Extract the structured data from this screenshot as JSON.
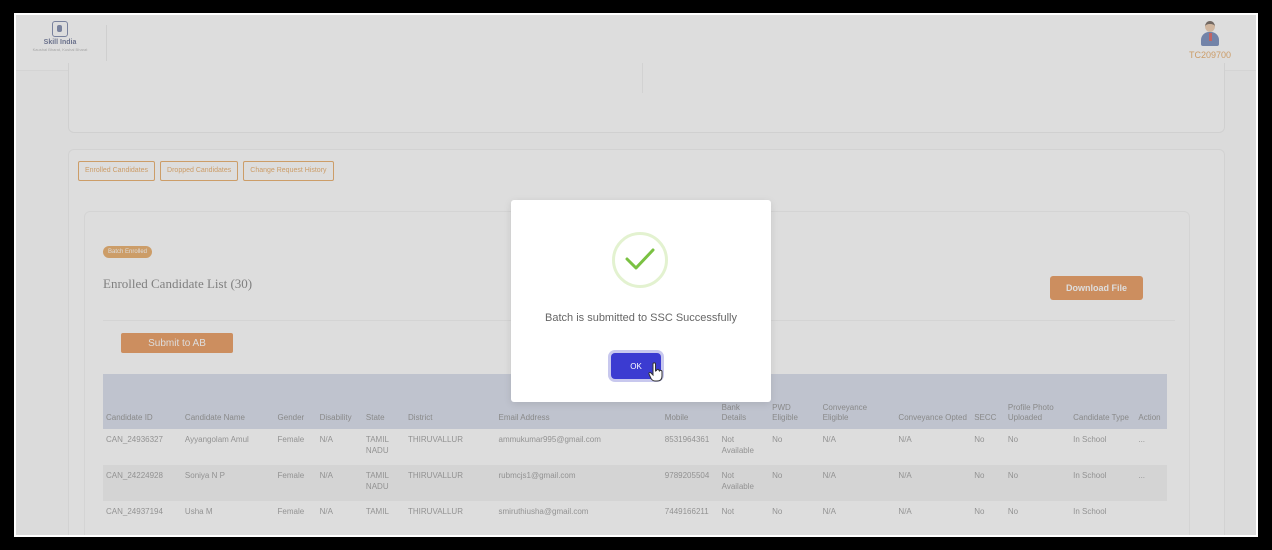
{
  "header": {
    "logo_title": "Skill India",
    "logo_subtitle": "Kaushal Bharat, Kushal Bharat",
    "user_id": "TC209700",
    "user_icon": "user-avatar-icon"
  },
  "tabs": [
    "Enrolled Candidates",
    "Dropped Candidates",
    "Change Request History"
  ],
  "badge": "Batch Enrolled",
  "list_title": "Enrolled Candidate List (30)",
  "download_label": "Download File",
  "submit_label": "Submit to AB",
  "table": {
    "columns": [
      "Candidate ID",
      "Candidate Name",
      "Gender",
      "Disability",
      "State",
      "District",
      "Email Address",
      "Mobile",
      "Bank Details",
      "PWD Eligible",
      "Conveyance Eligible",
      "Conveyance Opted",
      "SECC",
      "Profile Photo Uploaded",
      "Candidate Type",
      "Action"
    ],
    "rows": [
      [
        "CAN_24936327",
        "Ayyangolam Amul",
        "Female",
        "N/A",
        "TAMIL NADU",
        "THIRUVALLUR",
        "ammukumar995@gmail.com",
        "8531964361",
        "Not Available",
        "No",
        "N/A",
        "N/A",
        "No",
        "No",
        "In School",
        "..."
      ],
      [
        "CAN_24224928",
        "Soniya N P",
        "Female",
        "N/A",
        "TAMIL NADU",
        "THIRUVALLUR",
        "rubmcjs1@gmail.com",
        "9789205504",
        "Not Available",
        "No",
        "N/A",
        "N/A",
        "No",
        "No",
        "In School",
        "..."
      ],
      [
        "CAN_24937194",
        "Usha M",
        "Female",
        "N/A",
        "TAMIL",
        "THIRUVALLUR",
        "smiruthiusha@gmail.com",
        "7449166211",
        "Not",
        "No",
        "N/A",
        "N/A",
        "No",
        "No",
        "In School",
        ""
      ]
    ]
  },
  "modal": {
    "icon": "success-check-icon",
    "message": "Batch is submitted to SSC Successfully",
    "ok_label": "OK"
  },
  "colors": {
    "accent_orange": "#e0701b",
    "ok_button": "#3b3bd1",
    "success_green": "#7ac142",
    "table_header": "#c8d0e3"
  }
}
